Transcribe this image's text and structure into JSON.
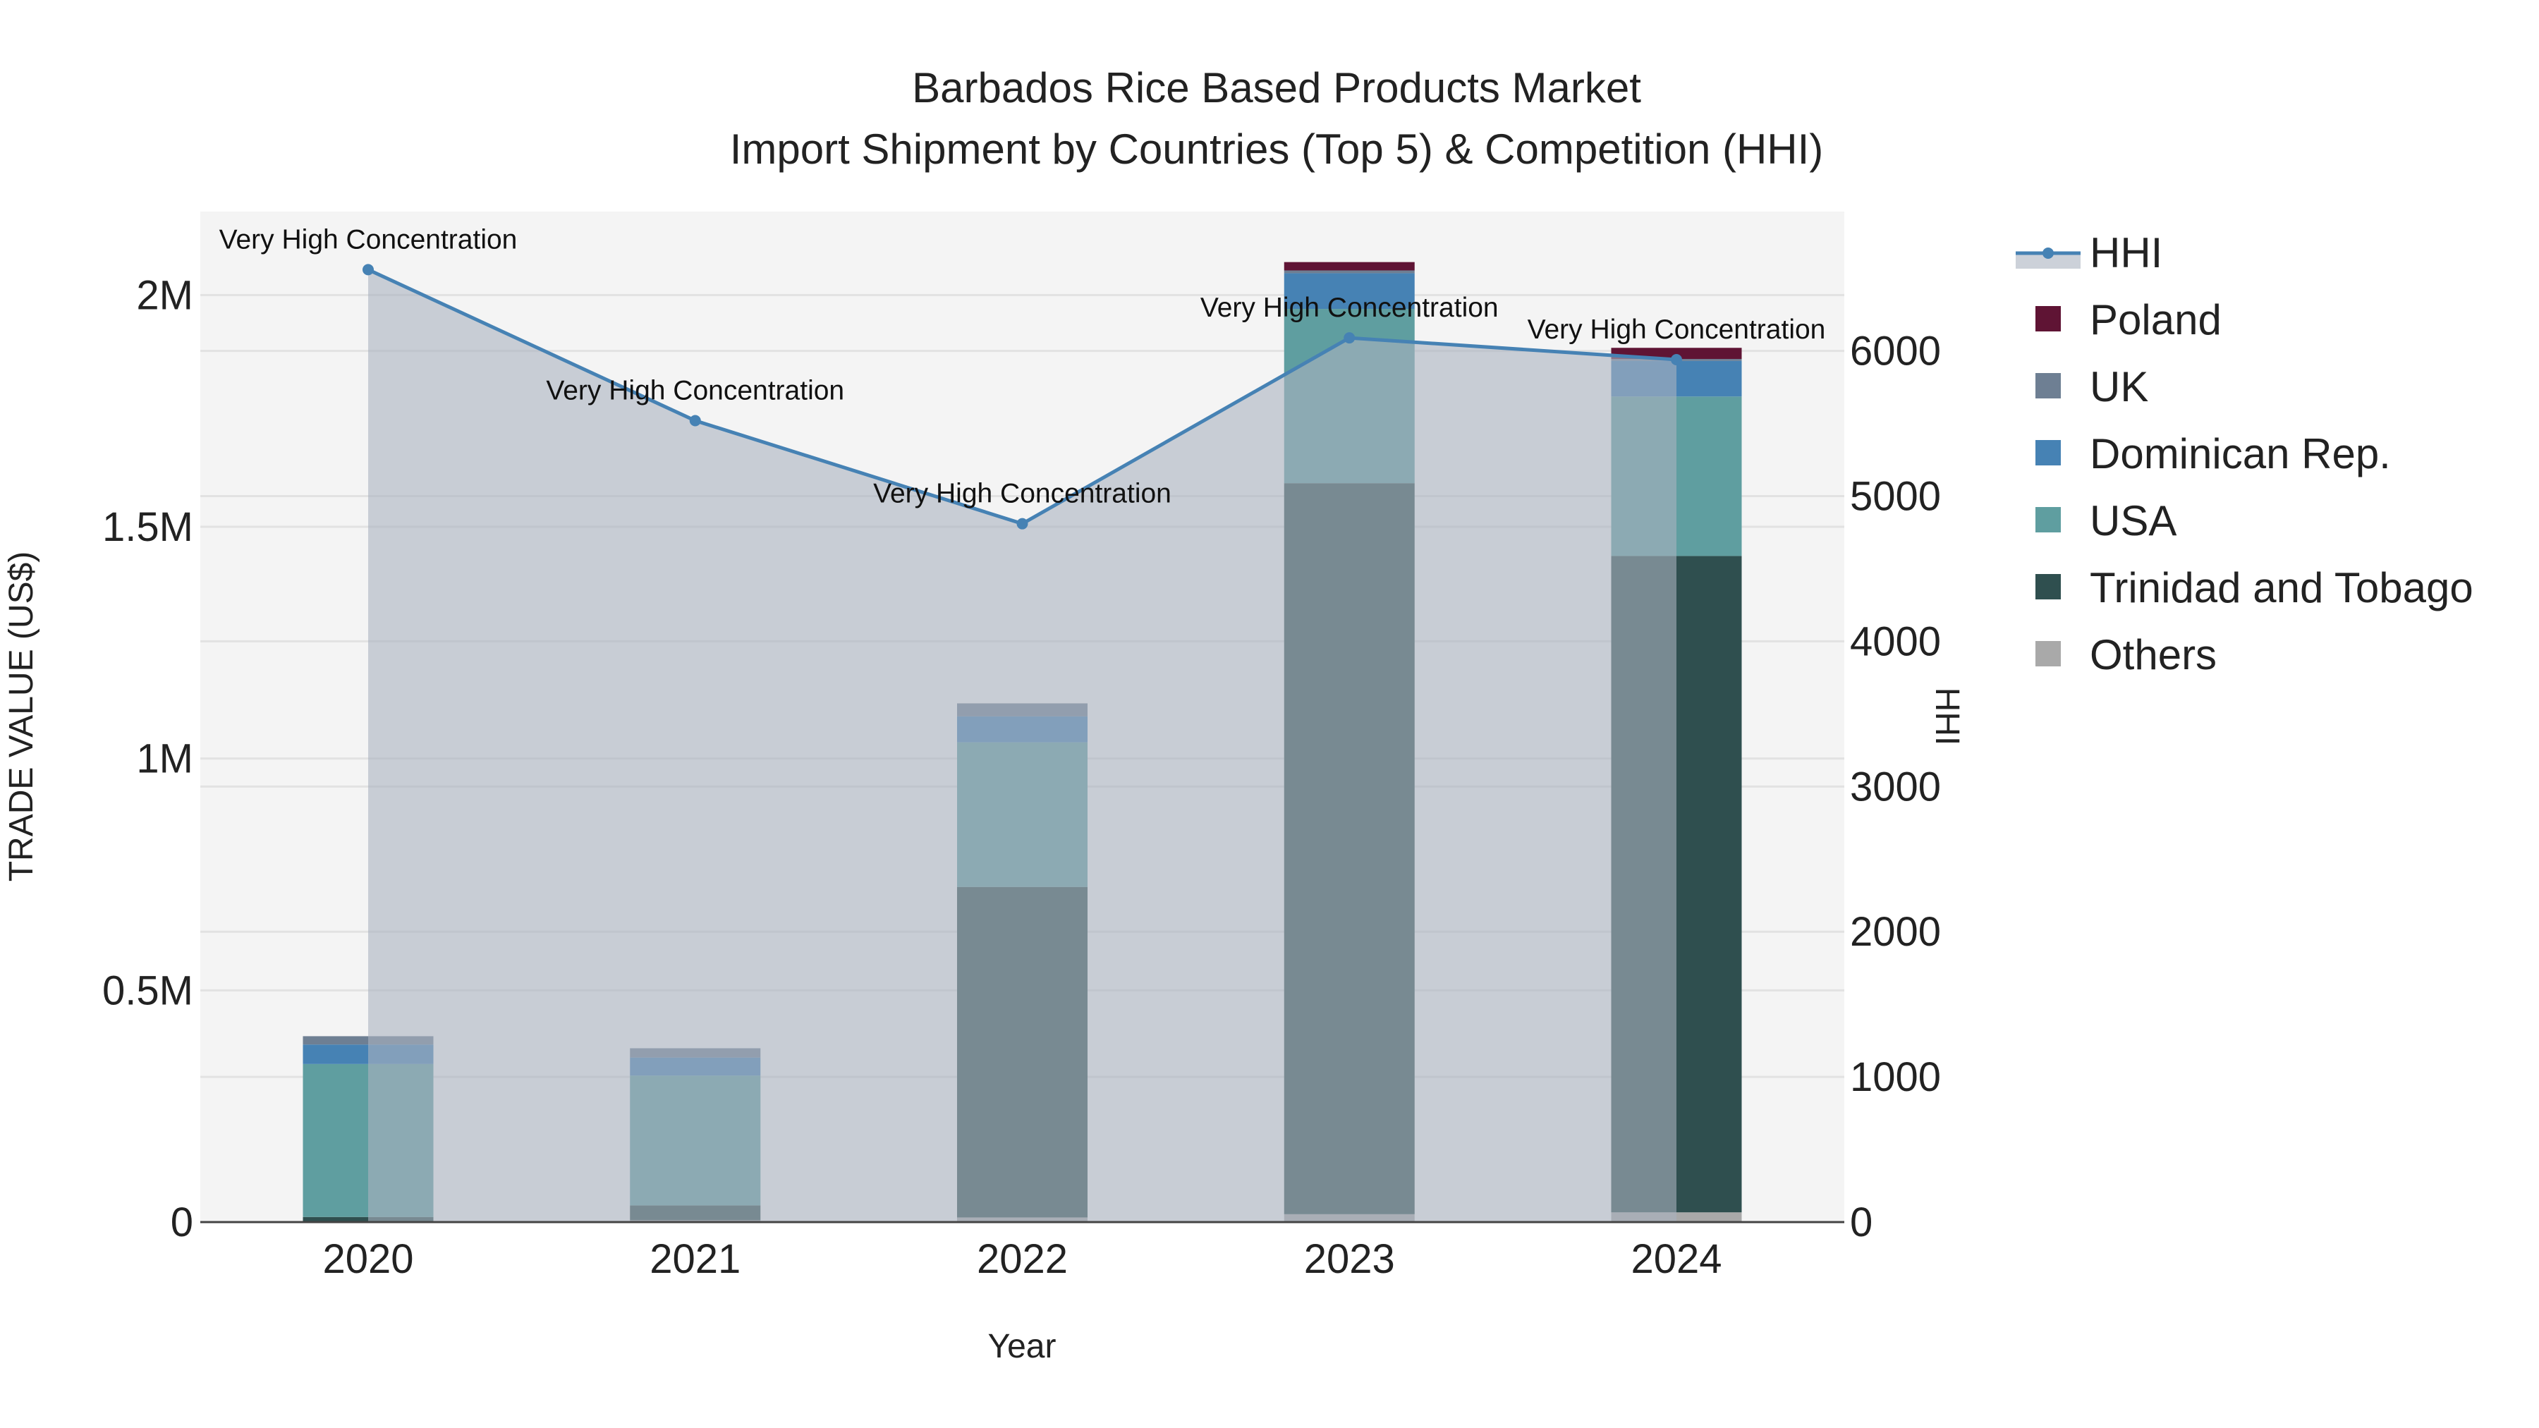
{
  "chart_data": {
    "type": "bar",
    "title_line1": "Barbados Rice Based Products Market",
    "title_line2": "Import Shipment by Countries (Top 5) & Competition (HHI)",
    "xlabel": "Year",
    "ylabel": "TRADE VALUE (US$)",
    "y2label": "HHI",
    "categories": [
      "2020",
      "2021",
      "2022",
      "2023",
      "2024"
    ],
    "ylim": [
      0,
      2180000
    ],
    "y2lim": [
      0,
      6960
    ],
    "yticks": [
      {
        "v": 0,
        "label": "0"
      },
      {
        "v": 500000,
        "label": "0.5M"
      },
      {
        "v": 1000000,
        "label": "1M"
      },
      {
        "v": 1500000,
        "label": "1.5M"
      },
      {
        "v": 2000000,
        "label": "2M"
      }
    ],
    "y2ticks": [
      0,
      1000,
      2000,
      3000,
      4000,
      5000,
      6000
    ],
    "series": [
      {
        "name": "Others",
        "color": "#a9a9a9",
        "values": [
          2000,
          4000,
          10000,
          17000,
          21000
        ]
      },
      {
        "name": "Trinidad and Tobago",
        "color": "#2f4f4f",
        "values": [
          9000,
          32000,
          713000,
          1577000,
          1416000
        ]
      },
      {
        "name": "USA",
        "color": "#5f9ea0",
        "values": [
          330000,
          280000,
          312000,
          376000,
          344000
        ]
      },
      {
        "name": "Dominican Rep.",
        "color": "#4682b4",
        "values": [
          42000,
          39000,
          56000,
          77000,
          77000
        ]
      },
      {
        "name": "UK",
        "color": "#6e7f93",
        "values": [
          18000,
          20000,
          28000,
          6000,
          4000
        ]
      },
      {
        "name": "Poland",
        "color": "#5f1434",
        "values": [
          0,
          0,
          0,
          18000,
          24000
        ]
      }
    ],
    "hhi": {
      "name": "HHI",
      "color": "#4682b4",
      "values": [
        6560,
        5520,
        4810,
        6090,
        5940
      ]
    },
    "annotations": [
      "Very High Concentration",
      "Very High Concentration",
      "Very High Concentration",
      "Very High Concentration",
      "Very High Concentration"
    ],
    "legend": [
      "HHI",
      "Poland",
      "UK",
      "Dominican Rep.",
      "USA",
      "Trinidad and Tobago",
      "Others"
    ],
    "legend_position": "right"
  }
}
